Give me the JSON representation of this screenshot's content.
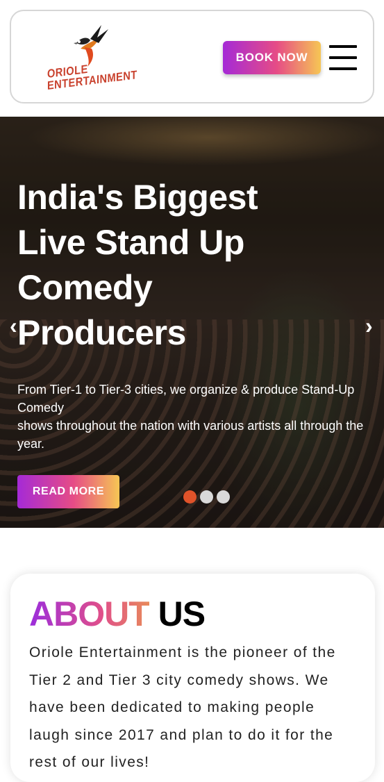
{
  "header": {
    "logo_text_line1": "ORIOLE",
    "logo_text_line2": "ENTERTAINMENT",
    "book_label": "BOOK NOW",
    "menu_icon": "hamburger-icon"
  },
  "hero": {
    "title": "India's Biggest Live Stand Up Comedy Producers",
    "description_line1": "From Tier-1 to Tier-3 cities, we organize & produce Stand-Up Comedy",
    "description_line2": "shows throughout the nation with various artists all through the year.",
    "read_more_label": "READ MORE",
    "prev_arrow": "‹",
    "next_arrow": "›",
    "slide_count": 3,
    "active_slide": 1
  },
  "about": {
    "title_part1": "ABOUT",
    "title_part2": "US",
    "text": "Oriole Entertainment is the pioneer of the Tier 2 and Tier 3 city comedy shows. We have been dedicated to making people laugh since 2017 and plan to do it for the rest of our lives!"
  },
  "colors": {
    "accent_start": "#a52ad6",
    "accent_mid": "#e64c86",
    "accent_end": "#f6c654",
    "active_dot": "#e0532a"
  }
}
